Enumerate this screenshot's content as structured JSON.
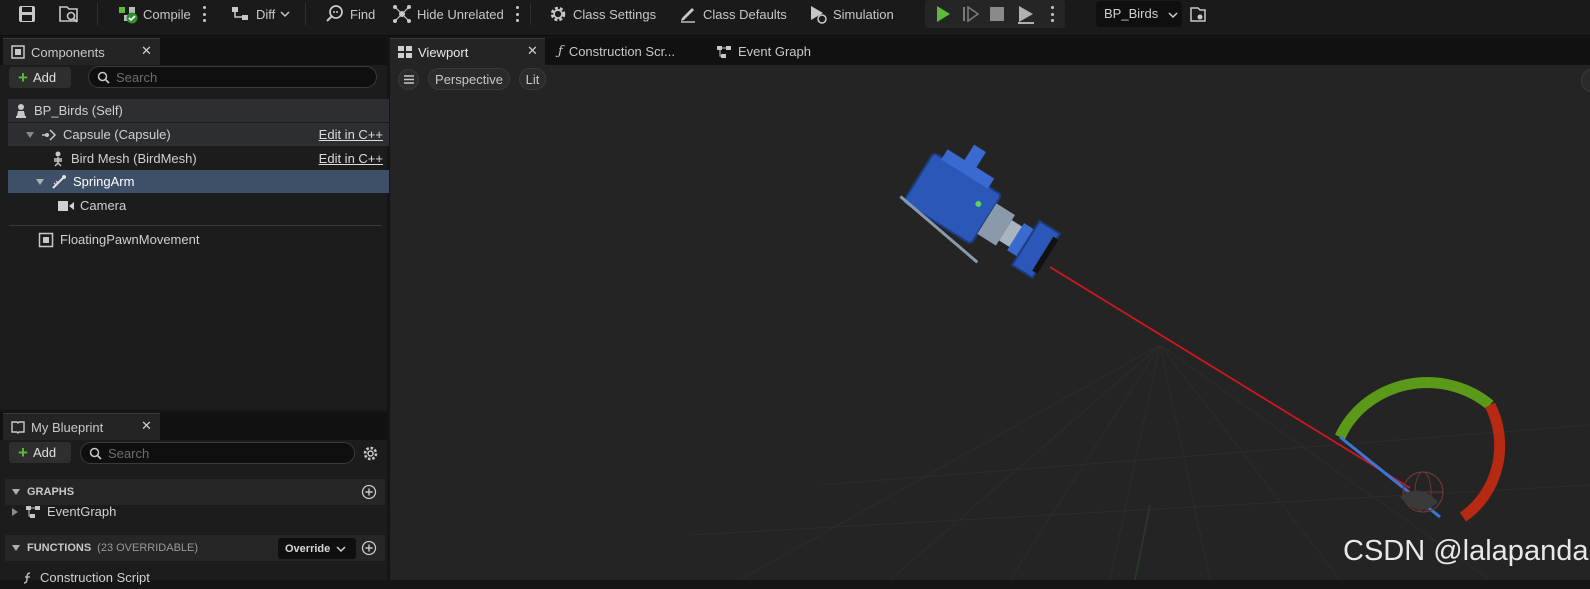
{
  "toolbar": {
    "compile_label": "Compile",
    "diff_label": "Diff",
    "find_label": "Find",
    "hide_unrelated_label": "Hide Unrelated",
    "class_settings_label": "Class Settings",
    "class_defaults_label": "Class Defaults",
    "simulation_label": "Simulation",
    "blueprint_selector": "BP_Birds"
  },
  "components_panel": {
    "tab_label": "Components",
    "add_label": "Add",
    "search_placeholder": "Search",
    "items": [
      {
        "label": "BP_Birds (Self)",
        "icon": "pawn-icon"
      },
      {
        "label": "Capsule (Capsule)",
        "icon": "capsule-icon",
        "edit_link": "Edit in C++"
      },
      {
        "label": "Bird Mesh (BirdMesh)",
        "icon": "skeleton-icon",
        "edit_link": "Edit in C++"
      },
      {
        "label": "SpringArm",
        "icon": "spring-arm-icon",
        "selected": true
      },
      {
        "label": "Camera",
        "icon": "camera-icon"
      },
      {
        "label": "FloatingPawnMovement",
        "icon": "movement-component-icon"
      }
    ]
  },
  "my_blueprint_panel": {
    "tab_label": "My Blueprint",
    "add_label": "Add",
    "search_placeholder": "Search",
    "graphs_header": "GRAPHS",
    "graphs": [
      {
        "label": "EventGraph"
      }
    ],
    "functions_header": "FUNCTIONS",
    "functions_count": "(23 OVERRIDABLE)",
    "override_label": "Override",
    "functions": [
      {
        "label": "Construction Script"
      }
    ]
  },
  "editor_tabs": [
    {
      "label": "Viewport",
      "active": true
    },
    {
      "label": "Construction Scr...",
      "active": false
    },
    {
      "label": "Event Graph",
      "active": false
    }
  ],
  "viewport": {
    "perspective_label": "Perspective",
    "lit_label": "Lit",
    "watermark": "CSDN @lalapanda"
  },
  "colors": {
    "accent_selected": "#3d5068",
    "play_green": "#5dbb3b",
    "camera_blue": "#2b57b8",
    "spring_arm_red": "#c8141c",
    "arc_green": "#5a9a18",
    "arc_red": "#b52a10"
  }
}
